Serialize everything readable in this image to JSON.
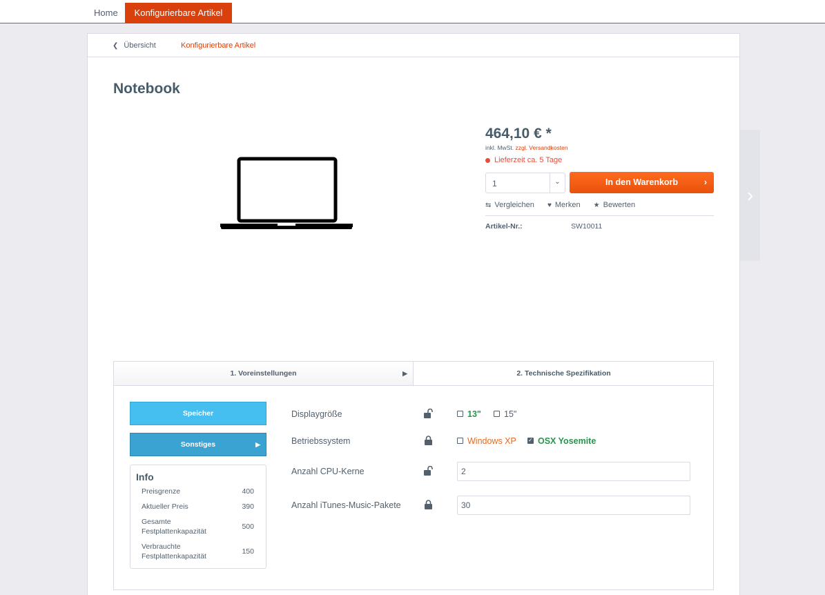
{
  "topnav": {
    "home": "Home",
    "active": "Konfigurierbare Artikel"
  },
  "breadcrumb": {
    "back": "Übersicht",
    "current": "Konfigurierbare Artikel"
  },
  "product": {
    "title": "Notebook",
    "image_icon": "laptop-icon",
    "price": "464,10 € *",
    "tax_prefix": "inkl. MwSt.",
    "shipping_link": "zzgl. Versandkosten",
    "delivery": "Lieferzeit ca. 5 Tage",
    "quantity": "1",
    "cart_button": "In den Warenkorb",
    "compare": "Vergleichen",
    "remember": "Merken",
    "rate": "Bewerten",
    "artnr_label": "Artikel-Nr.:",
    "artnr_value": "SW10011"
  },
  "configurator": {
    "tab1": "1. Voreinstellungen",
    "tab2": "2. Technische Spezifikation",
    "speicher": "Speicher",
    "sonstiges": "Sonstiges",
    "info": {
      "title": "Info",
      "rows": [
        {
          "label": "Preisgrenze",
          "value": "400"
        },
        {
          "label": "Aktueller Preis",
          "value": "390"
        },
        {
          "label": "Gesamte Festplattenkapazität",
          "value": "500"
        },
        {
          "label": "Verbrauchte Festplattenkapazität",
          "value": "150"
        }
      ]
    },
    "options": {
      "display": {
        "label": "Displaygröße",
        "lock": "unlocked",
        "choices": [
          "13\"",
          "15\""
        ],
        "checked": "none"
      },
      "os": {
        "label": "Betriebssystem",
        "lock": "locked",
        "choices": [
          "Windows XP",
          "OSX Yosemite"
        ],
        "checked": "OSX Yosemite"
      },
      "cpu": {
        "label": "Anzahl CPU-Kerne",
        "lock": "unlocked",
        "value": "2"
      },
      "itunes": {
        "label": "Anzahl iTunes-Music-Pakete",
        "lock": "locked",
        "value": "30"
      }
    }
  },
  "colors": {
    "accent": "#d9400b",
    "cart": "#ff6a1f",
    "green": "#27944d",
    "blue": "#45bff0"
  }
}
